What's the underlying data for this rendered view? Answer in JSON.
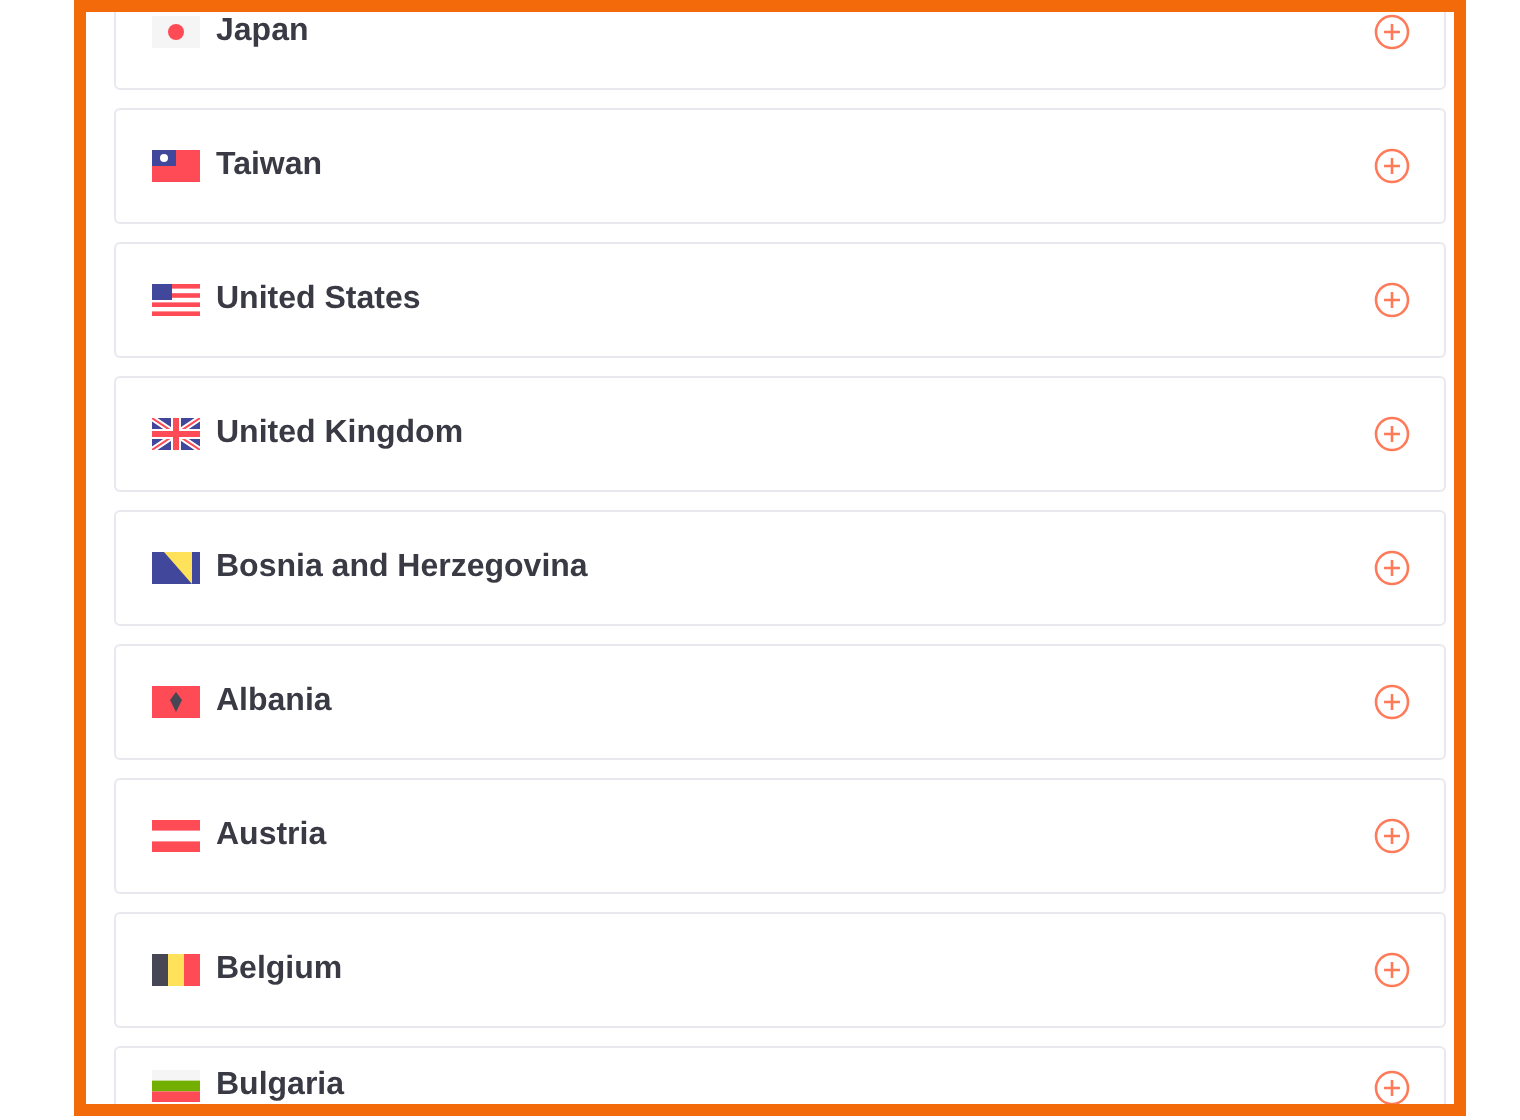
{
  "countries": [
    {
      "name": "Japan",
      "kind": "japan"
    },
    {
      "name": "Taiwan",
      "kind": "taiwan"
    },
    {
      "name": "United States",
      "kind": "us"
    },
    {
      "name": "United Kingdom",
      "kind": "uk"
    },
    {
      "name": "Bosnia and Herzegovina",
      "kind": "bosnia"
    },
    {
      "name": "Albania",
      "kind": "albania"
    },
    {
      "name": "Austria",
      "kind": "austria"
    },
    {
      "name": "Belgium",
      "kind": "belgium"
    },
    {
      "name": "Bulgaria",
      "kind": "bulgaria"
    }
  ]
}
